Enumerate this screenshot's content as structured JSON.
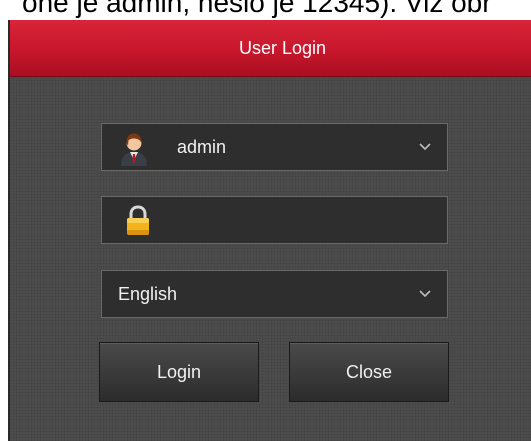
{
  "caption": {
    "text": "one je admin, heslo je 12345). Viz obr"
  },
  "dialog": {
    "title": "User Login",
    "username": {
      "value": "admin",
      "icon": "user-avatar-icon",
      "dropdown_icon": "chevron-down-icon"
    },
    "password": {
      "value": "",
      "icon": "lock-icon"
    },
    "language": {
      "value": "English",
      "dropdown_icon": "chevron-down-icon"
    },
    "buttons": {
      "login": "Login",
      "close": "Close"
    }
  },
  "colors": {
    "titlebar": "#c8162c",
    "panel": "#4c4c4c",
    "field": "#2e2e2e",
    "text": "#f0f0f0",
    "lock": "#f2b31c"
  }
}
